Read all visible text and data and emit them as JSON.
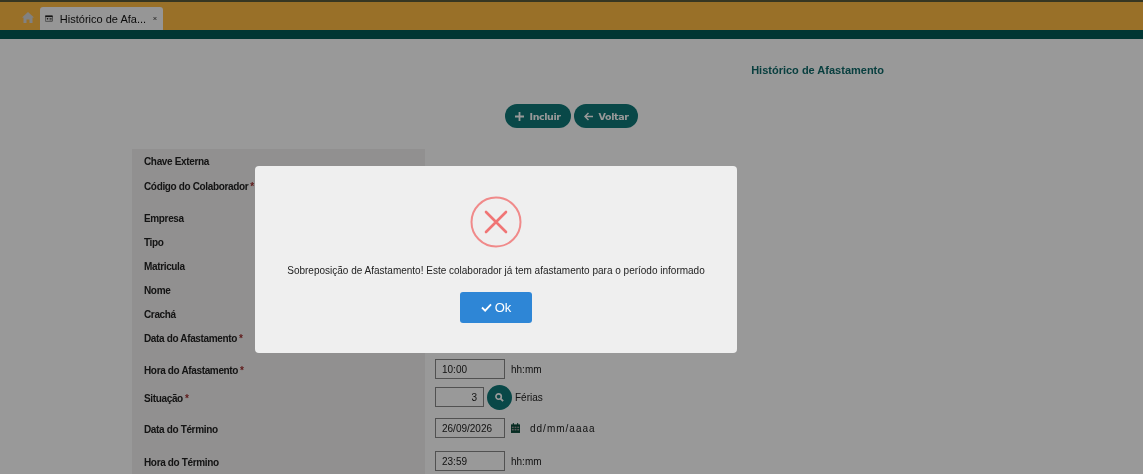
{
  "tabs": [
    {
      "label": "Histórico de Afa...",
      "selected": true
    }
  ],
  "page_title": "Histórico de Afastamento",
  "toolbar": [
    {
      "kind": "add",
      "label": "Incluir"
    },
    {
      "kind": "back",
      "label": "Voltar"
    }
  ],
  "form": [
    {
      "label": "Chave Externa"
    },
    {
      "label": "Código do Colaborador",
      "required_mark": "*"
    },
    {
      "label": "Empresa"
    },
    {
      "label": "Tipo"
    },
    {
      "label": "Matricula"
    },
    {
      "label": "Nome"
    },
    {
      "label": "Crachá"
    },
    {
      "label": "Data do Afastamento",
      "required_mark": "*"
    },
    {
      "label": "Hora do Afastamento",
      "required_mark": "*",
      "kind": "time",
      "value": "10:00",
      "hint": "hh:mm"
    },
    {
      "label": "Situação",
      "required_mark": "*",
      "kind": "lookup",
      "value": "3",
      "description": "Férias"
    },
    {
      "label": "Data do Término",
      "kind": "date",
      "value": "26/09/2026",
      "hint": "dd/mm/aaaa"
    },
    {
      "label": "Hora do Término",
      "kind": "time",
      "value": "23:59",
      "hint": "hh:mm"
    }
  ],
  "dialog": {
    "kind": "error",
    "message": "Sobreposição de Afastamento! Este colaborador já tem afastamento para o período informado",
    "button": "Ok"
  }
}
